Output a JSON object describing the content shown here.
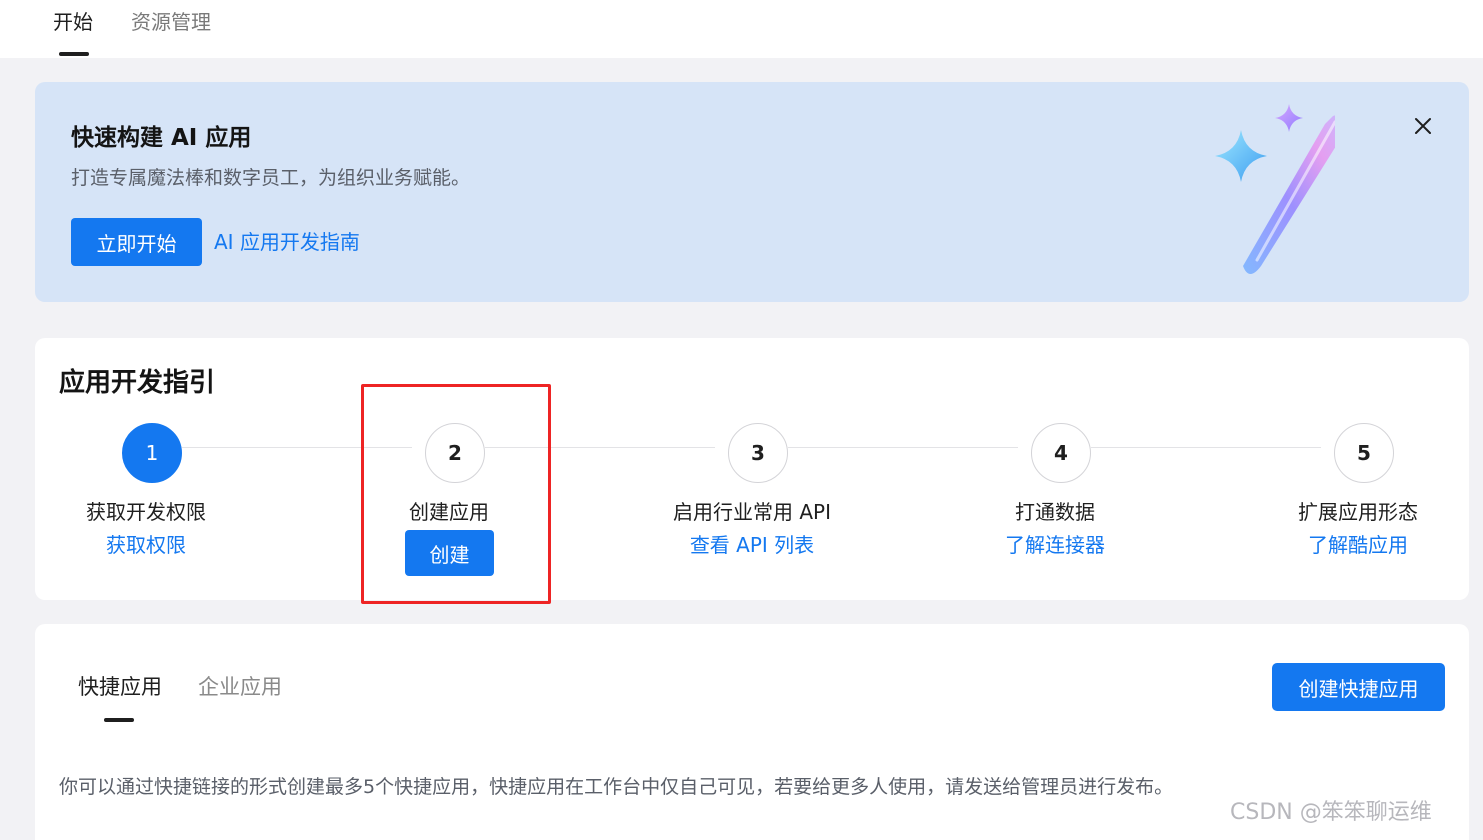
{
  "top_tabs": [
    {
      "label": "开始",
      "active": true
    },
    {
      "label": "资源管理",
      "active": false
    }
  ],
  "banner": {
    "title": "快速构建 AI 应用",
    "subtitle": "打造专属魔法棒和数字员工，为组织业务赋能。",
    "start_button": "立即开始",
    "guide_link": "AI 应用开发指南",
    "close_icon": "close-icon",
    "art_icon": "magic-wand-icon"
  },
  "guide": {
    "title": "应用开发指引",
    "steps": [
      {
        "number": "1",
        "label": "获取开发权限",
        "action": "获取权限",
        "action_type": "link",
        "active": true
      },
      {
        "number": "2",
        "label": "创建应用",
        "action": "创建",
        "action_type": "button",
        "active": false
      },
      {
        "number": "3",
        "label": "启用行业常用 API",
        "action": "查看 API 列表",
        "action_type": "link",
        "active": false
      },
      {
        "number": "4",
        "label": "打通数据",
        "action": "了解连接器",
        "action_type": "link",
        "active": false
      },
      {
        "number": "5",
        "label": "扩展应用形态",
        "action": "了解酷应用",
        "action_type": "link",
        "active": false
      }
    ]
  },
  "apps": {
    "tabs": [
      {
        "label": "快捷应用",
        "active": true
      },
      {
        "label": "企业应用",
        "active": false
      }
    ],
    "create_button": "创建快捷应用",
    "description": "你可以通过快捷链接的形式创建最多5个快捷应用，快捷应用在工作台中仅自己可见，若要给更多人使用，请发送给管理员进行发布。"
  },
  "watermark": "CSDN @笨笨聊运维",
  "colors": {
    "primary": "#1478f0",
    "banner_bg": "#d6e4f7",
    "highlight": "#ee2424"
  }
}
